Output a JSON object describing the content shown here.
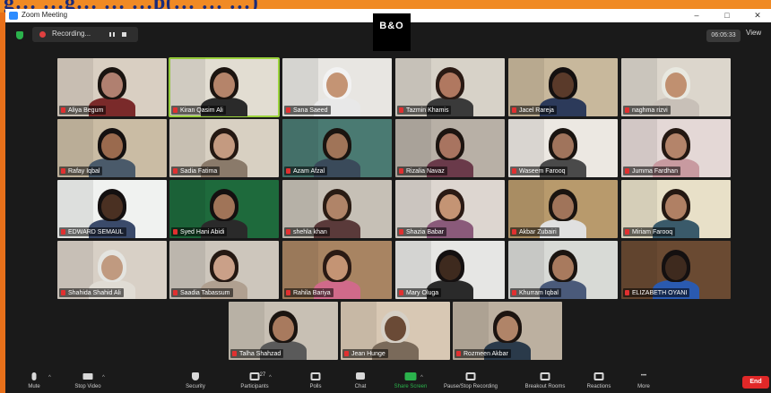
{
  "banner": {
    "text": "g…   …g…   …                                       …p(… …  …)"
  },
  "window": {
    "title": "Zoom Meeting",
    "controls": [
      "–",
      "□",
      "✕"
    ]
  },
  "topbar": {
    "recording_label": "Recording...",
    "logo_text": "B&O",
    "timer": "06:05:33",
    "view_label": "View"
  },
  "participants": [
    {
      "name": "Aliya Begum",
      "tone": "#b08070",
      "bg": "#d9cfc2",
      "hair": "#1a1410",
      "shirt": "#7a2a2a"
    },
    {
      "name": "Kiran Qasim Ali",
      "tone": "#b5846a",
      "bg": "#e2ddd2",
      "hair": "#1c1410",
      "shirt": "#2a2a2a",
      "speaking": true
    },
    {
      "name": "Sana Saeed",
      "tone": "#c49474",
      "bg": "#e8e6e2",
      "hair": "#f2f2f2",
      "shirt": "#e8e8e8"
    },
    {
      "name": "Tazmin Khamis",
      "tone": "#b07860",
      "bg": "#d7d2c8",
      "hair": "#2a1a14",
      "shirt": "#3a3a3a"
    },
    {
      "name": "Jacel Rareja",
      "tone": "#5a3a2a",
      "bg": "#c8b89c",
      "hair": "#141010",
      "shirt": "#2c3a5a"
    },
    {
      "name": "naghma rizvi",
      "tone": "#c09070",
      "bg": "#dcd6cc",
      "hair": "#e8e8e0",
      "shirt": "#c8c0b8"
    },
    {
      "name": "Rafay Iqbal",
      "tone": "#9a6a4e",
      "bg": "#cabca4",
      "hair": "#141010",
      "shirt": "#4a5a6a"
    },
    {
      "name": "Sadia Fatima",
      "tone": "#c49a80",
      "bg": "#d8d0c2",
      "hair": "#241812",
      "shirt": "#8a7a6a"
    },
    {
      "name": "Azam Afzal",
      "tone": "#a07458",
      "bg": "#4a7a72",
      "hair": "#1a1410",
      "shirt": "#3a4a5a"
    },
    {
      "name": "Rizalia Navaz",
      "tone": "#a87460",
      "bg": "#b8b0a6",
      "hair": "#1c1410",
      "shirt": "#6a3a4a"
    },
    {
      "name": "Waseem Farooq",
      "tone": "#a0745c",
      "bg": "#ece8e2",
      "hair": "#1a1410",
      "shirt": "#4a4a4a"
    },
    {
      "name": "Jumma Fardhan",
      "tone": "#b4846a",
      "bg": "#e4d8d6",
      "hair": "#241812",
      "shirt": "#c89aa0"
    },
    {
      "name": "EDWARD SEMAUL",
      "tone": "#4a3022",
      "bg": "#f0f2f0",
      "hair": "#141010",
      "shirt": "#3a4a6a"
    },
    {
      "name": "Syed Hani Abidi",
      "tone": "#a07458",
      "bg": "#1e6a3c",
      "hair": "#141010",
      "shirt": "#2a2a2a"
    },
    {
      "name": "shehla khan",
      "tone": "#b08468",
      "bg": "#c6c0b6",
      "hair": "#2a1c14",
      "shirt": "#5a3a3a"
    },
    {
      "name": "Shazia Babar",
      "tone": "#c49474",
      "bg": "#ddd6d0",
      "hair": "#2a1a14",
      "shirt": "#8a5a7a"
    },
    {
      "name": "Akbar Zubairi",
      "tone": "#a0745a",
      "bg": "#b89a6c",
      "hair": "#1a1410",
      "shirt": "#e0e0e0"
    },
    {
      "name": "Miriam Farooq",
      "tone": "#b08064",
      "bg": "#e8e0c8",
      "hair": "#241812",
      "shirt": "#3a5a6a"
    },
    {
      "name": "Shahida Shahid Ali",
      "tone": "#c09a80",
      "bg": "#d8d0c6",
      "hair": "#e4e4e0",
      "shirt": "#e0dcd4"
    },
    {
      "name": "Saadia Tabassum",
      "tone": "#caa088",
      "bg": "#cdc6bc",
      "hair": "#241812",
      "shirt": "#b0a090"
    },
    {
      "name": "Rahila Bariya",
      "tone": "#c49474",
      "bg": "#a88462",
      "hair": "#2a1a14",
      "shirt": "#d06a8a"
    },
    {
      "name": "Mary Oluga",
      "tone": "#3e2a1e",
      "bg": "#e6e6e4",
      "hair": "#141010",
      "shirt": "#2a2a2a"
    },
    {
      "name": "Khurram Iqbal",
      "tone": "#a87a5e",
      "bg": "#d8dad6",
      "hair": "#1a1410",
      "shirt": "#4a5a7a"
    },
    {
      "name": "ELIZABETH OYANI",
      "tone": "#3e2a1e",
      "bg": "#6a4a32",
      "hair": "#141010",
      "shirt": "#2a5ab0"
    },
    {
      "name": "Talha Shahzad",
      "tone": "#a87a5e",
      "bg": "#c8c0b4",
      "hair": "#1a1410",
      "shirt": "#5a5a5a"
    },
    {
      "name": "Jean Hunge",
      "tone": "#6a4a36",
      "bg": "#d8c8b4",
      "hair": "#d6d0c6",
      "shirt": "#7a6a5a"
    },
    {
      "name": "Rozmeen Akbar",
      "tone": "#b08468",
      "bg": "#bcb0a0",
      "hair": "#1c1410",
      "shirt": "#2a3a4a"
    }
  ],
  "toolbar": {
    "buttons": [
      {
        "label": "Mute",
        "icon": "microphone-icon"
      },
      {
        "label": "Stop Video",
        "icon": "video-camera-icon"
      },
      {
        "label": "Security",
        "icon": "shield-icon"
      },
      {
        "label": "Participants",
        "icon": "participants-icon",
        "count": "27"
      },
      {
        "label": "Polls",
        "icon": "polls-icon"
      },
      {
        "label": "Chat",
        "icon": "chat-icon"
      },
      {
        "label": "Share Screen",
        "icon": "share-screen-icon"
      },
      {
        "label": "Pause/Stop Recording",
        "icon": "recording-icon"
      },
      {
        "label": "Breakout Rooms",
        "icon": "breakout-rooms-icon"
      },
      {
        "label": "Reactions",
        "icon": "reactions-icon"
      },
      {
        "label": "More",
        "icon": "more-icon"
      }
    ],
    "end_label": "End"
  }
}
